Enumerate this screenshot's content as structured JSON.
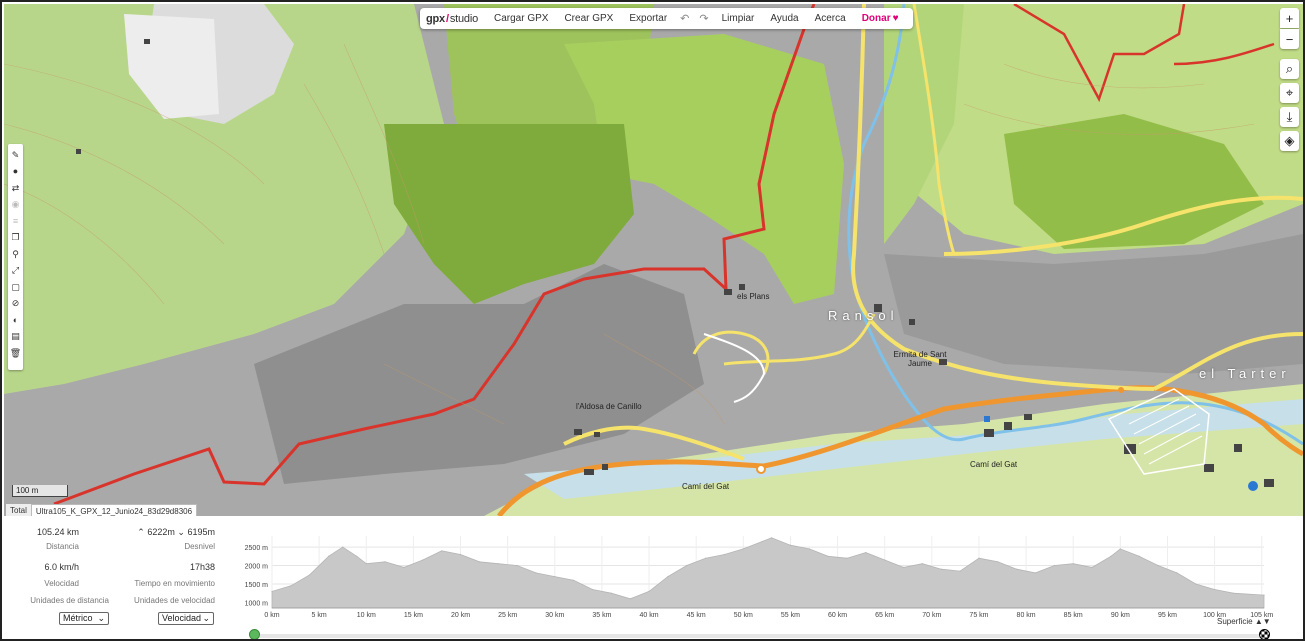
{
  "menu": {
    "logo_left": "gpx",
    "logo_right": "studio",
    "items": [
      "Cargar GPX",
      "Crear GPX",
      "Exportar"
    ],
    "undo_icon": "↶",
    "redo_icon": "↷",
    "items2": [
      "Limpiar",
      "Ayuda",
      "Acerca"
    ],
    "donate": "Donar",
    "heart": "♥"
  },
  "map": {
    "scale_label": "100 m",
    "labels": {
      "els_plans": "els Plans",
      "ransol": "Ransol",
      "ermita": "Ermita de Sant Jaume",
      "aldosa": "l'Aldosa de Canillo",
      "cami_gat_1": "Camí del Gat",
      "cami_gat_2": "Camí del Gat",
      "el_tarter": "el Tarter"
    }
  },
  "file_tab": {
    "total": "Total",
    "filename": "Ultra105_K_GPX_12_Junio24_83d29d8306"
  },
  "stats": {
    "distance_value": "105.24 km",
    "distance_label": "Distancia",
    "elev_up": "6222m",
    "elev_down": "6195m",
    "elevation_label": "Desnivel",
    "speed_value": "6.0 km/h",
    "speed_label": "Velocidad",
    "moving_time_value": "17h38",
    "moving_time_label": "Tiempo en movimiento",
    "distance_units_label": "Unidades de distancia",
    "speed_units_label": "Unidades de velocidad",
    "distance_units_selected": "Métrico",
    "speed_units_selected": "Velocidad"
  },
  "elevation_chart": {
    "legend_label": "Superficie",
    "legend_arrows": "▲▼"
  },
  "chart_data": {
    "type": "area",
    "x_unit": "km",
    "y_unit": "m",
    "x_ticks": [
      "0 km",
      "5 km",
      "10 km",
      "15 km",
      "20 km",
      "25 km",
      "30 km",
      "35 km",
      "40 km",
      "45 km",
      "50 km",
      "55 km",
      "60 km",
      "65 km",
      "70 km",
      "75 km",
      "80 km",
      "85 km",
      "90 km",
      "95 km",
      "100 km",
      "105 km"
    ],
    "y_ticks": [
      "1000 m",
      "1500 m",
      "2000 m",
      "2500 m"
    ],
    "xlim": [
      0,
      105.24
    ],
    "ylim": [
      850,
      2800
    ],
    "color": "#c8c8c8",
    "x": [
      0,
      2,
      4,
      6,
      7.5,
      9,
      10,
      12,
      14,
      16,
      18,
      20,
      22,
      24,
      26,
      28,
      30,
      32,
      34,
      36,
      38,
      40,
      42,
      44,
      46,
      48,
      50,
      52,
      53,
      55,
      57,
      59,
      61,
      63,
      65,
      67,
      69,
      71,
      73,
      75,
      77,
      79,
      81,
      83,
      85,
      87,
      89,
      90,
      92,
      94,
      96,
      98,
      100,
      102,
      105.24
    ],
    "values": [
      1300,
      1450,
      1750,
      2250,
      2500,
      2250,
      2050,
      2100,
      1950,
      2150,
      2400,
      2300,
      2100,
      2050,
      2000,
      1800,
      1700,
      1600,
      1350,
      1250,
      1100,
      1300,
      1700,
      2000,
      2200,
      2300,
      2450,
      2650,
      2750,
      2550,
      2450,
      2250,
      2200,
      2350,
      2150,
      1950,
      2050,
      1900,
      1850,
      2200,
      2100,
      1900,
      1800,
      2000,
      2050,
      1950,
      2250,
      2450,
      2250,
      2000,
      1800,
      1500,
      1350,
      1250,
      1200
    ]
  }
}
